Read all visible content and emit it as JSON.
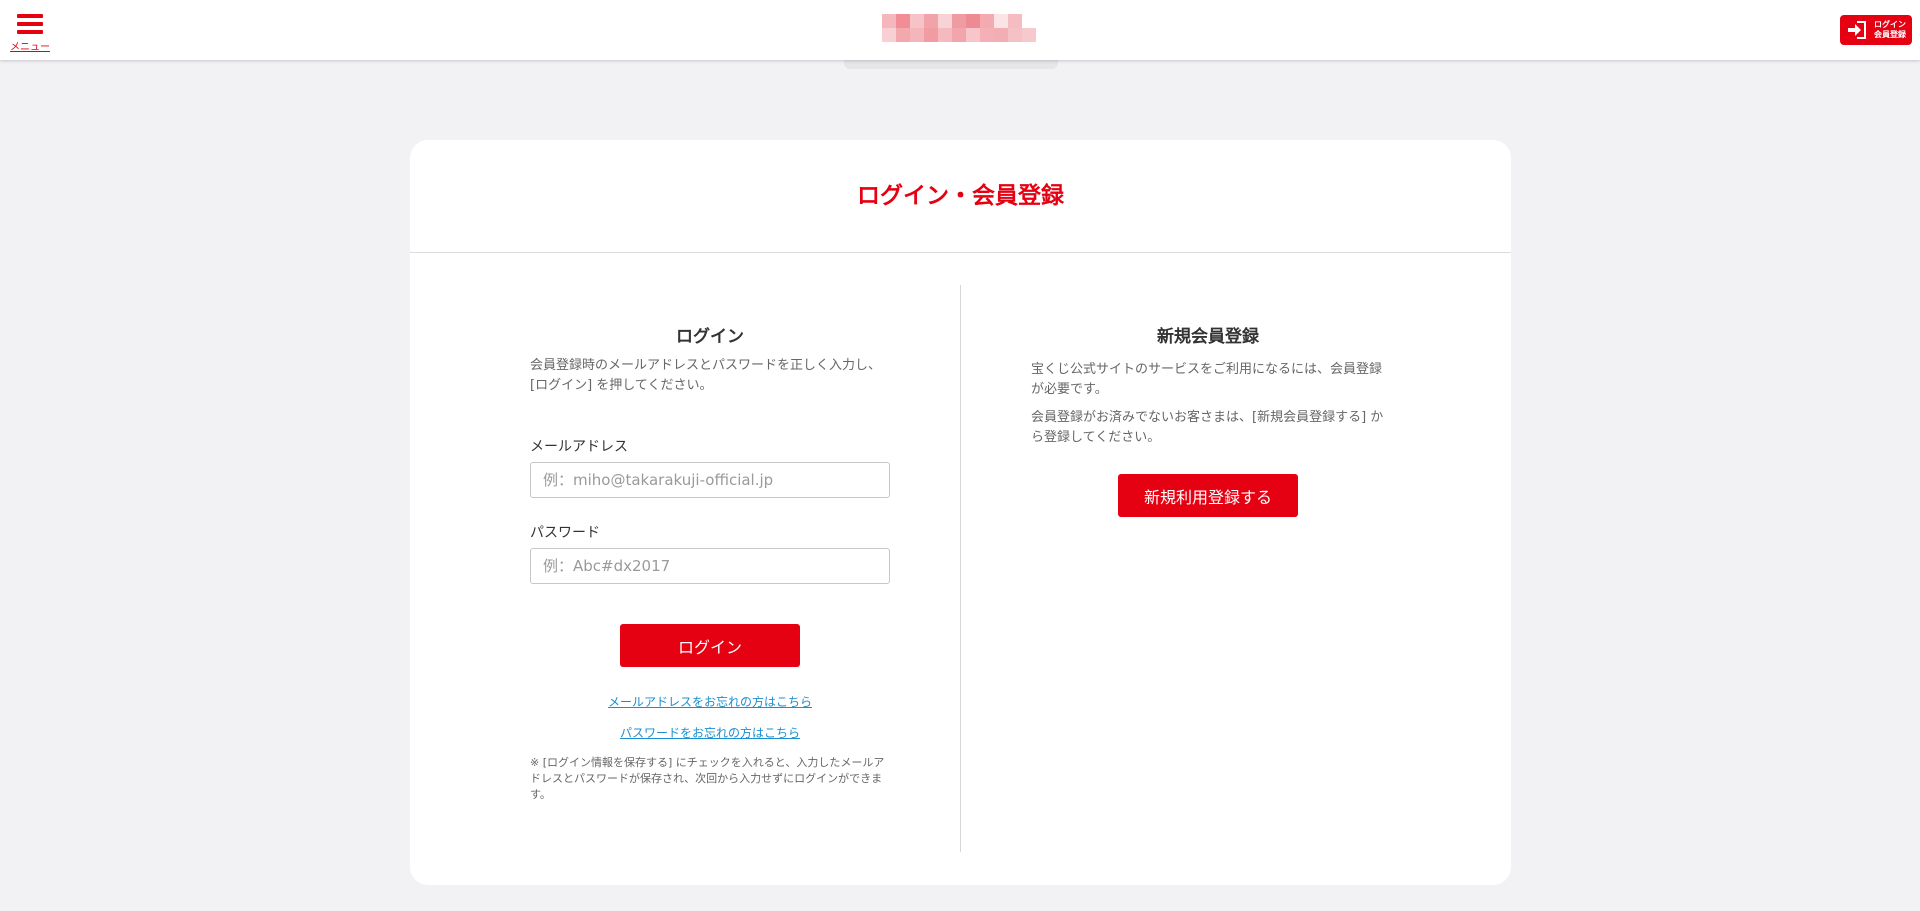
{
  "header": {
    "menu_label": "メニュー",
    "login_button_line1": "ログイン",
    "login_button_line2": "会員登録"
  },
  "colors": {
    "brand_red": "#e50012",
    "link_blue": "#1a8fd0",
    "background": "#f2f2f5"
  },
  "page": {
    "title": "ログイン・会員登録"
  },
  "login": {
    "heading": "ログイン",
    "description": "会員登録時のメールアドレスとパスワードを正しく入力し、[ログイン] を押してください。",
    "email_label": "メールアドレス",
    "email_placeholder": "例：miho@takarakuji-official.jp",
    "email_value": "",
    "password_label": "パスワード",
    "password_placeholder": "例：Abc#dx2017",
    "password_value": "",
    "submit_label": "ログイン",
    "forgot_email_link": "メールアドレスをお忘れの方はこちら",
    "forgot_password_link": "パスワードをお忘れの方はこちら",
    "note": "※ [ログイン情報を保存する] にチェックを入れると、入力したメールアドレスとパスワードが保存され、次回から入力せずにログインができます。"
  },
  "register": {
    "heading": "新規会員登録",
    "description_1": "宝くじ公式サイトのサービスをご利用になるには、会員登録が必要です。",
    "description_2": "会員登録がお済みでないお客さまは、[新規会員登録する] から登録してください。",
    "button_label": "新規利用登録する"
  },
  "icons": {
    "menu": "hamburger-icon",
    "login": "login-arrow-icon"
  }
}
